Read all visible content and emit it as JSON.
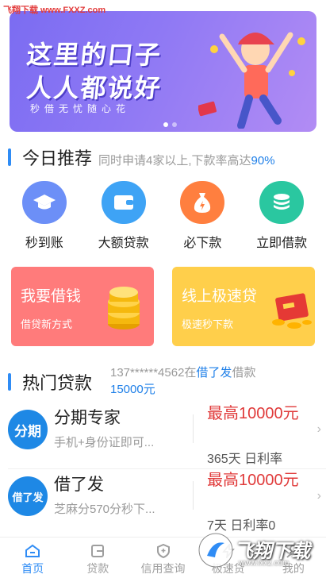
{
  "watermark": {
    "top_text": "飞翔下载 www.FXXZ.com",
    "corner_text": "飞翔下载",
    "corner_url": "www.fxxz.com"
  },
  "banner": {
    "line1": "这里的口子",
    "line2": "人人都说好",
    "subtitle": "秒借无忧随心花",
    "page_count": 2,
    "active_page": 1
  },
  "today": {
    "title": "今日推荐",
    "note_prefix": "同时申请4家以上,下款率高达",
    "note_highlight": "90%"
  },
  "quick_actions": [
    {
      "label": "秒到账",
      "icon": "graduation-cap-icon",
      "color": "#6c8ff7"
    },
    {
      "label": "大额贷款",
      "icon": "wallet-icon",
      "color": "#3ea3f5"
    },
    {
      "label": "必下款",
      "icon": "money-bag-icon",
      "color": "#ff7f3f"
    },
    {
      "label": "立即借款",
      "icon": "coin-stack-icon",
      "color": "#2ac7a0"
    }
  ],
  "promo_cards": [
    {
      "title": "我要借钱",
      "subtitle": "借贷新方式",
      "color": "#ff7b7b"
    },
    {
      "title": "线上极速贷",
      "subtitle": "极速秒下款",
      "color": "#ffcf4b"
    }
  ],
  "hot": {
    "title": "热门贷款",
    "ticker_phone": "137******4562在",
    "ticker_product": "借了发",
    "ticker_action": "借款",
    "ticker_amount": "15000元"
  },
  "loans": [
    {
      "logo": "分期",
      "name": "分期专家",
      "desc": "手机+身份证即可...",
      "amount": "最高10000元",
      "extra": "365天 日利率"
    },
    {
      "logo": "借了发",
      "name": "借了发",
      "desc": "芝麻分570分秒下...",
      "amount": "最高10000元",
      "extra": "7天 日利率0"
    }
  ],
  "tabs": [
    {
      "label": "首页",
      "icon": "home-icon",
      "active": true
    },
    {
      "label": "贷款",
      "icon": "loan-icon",
      "active": false
    },
    {
      "label": "信用查询",
      "icon": "shield-icon",
      "active": false
    },
    {
      "label": "极速贷",
      "icon": "lightning-icon",
      "active": false
    },
    {
      "label": "我的",
      "icon": "user-icon",
      "active": false
    }
  ],
  "colors": {
    "accent": "#2f8cf5",
    "amount_red": "#e03a3a"
  }
}
